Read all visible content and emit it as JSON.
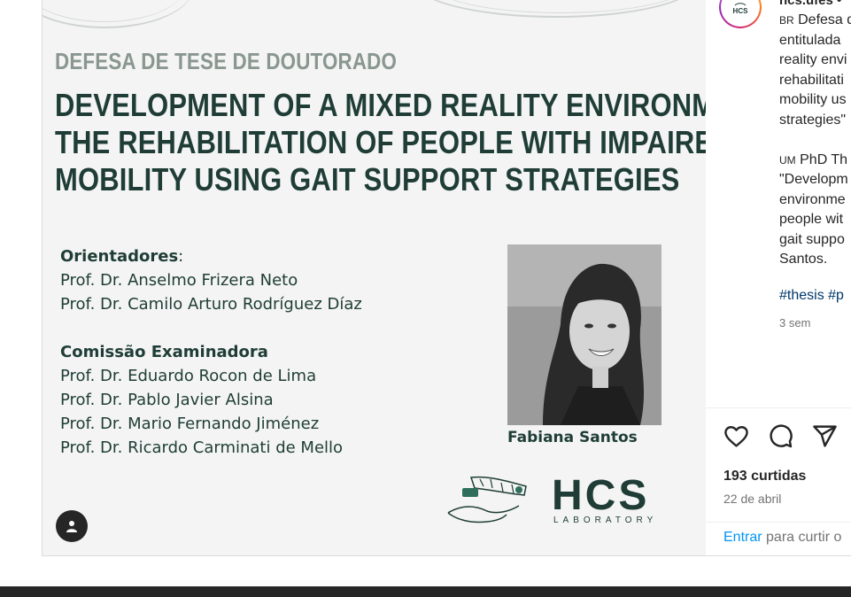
{
  "post": {
    "subtitle": "DEFESA DE TESE DE DOUTORADO",
    "title_lines": [
      "DEVELOPMENT OF A MIXED REALITY ENVIRONMENT FOR",
      "THE REHABILITATION OF PEOPLE WITH IMPAIRED",
      "MOBILITY USING GAIT SUPPORT STRATEGIES"
    ],
    "advisors_heading": "Orientadores",
    "advisors_colon": ":",
    "advisors": [
      "Prof. Dr. Anselmo Frizera Neto",
      "Prof. Dr. Camilo Arturo Rodríguez Díaz"
    ],
    "committee_heading": "Comissão Examinadora",
    "committee": [
      "Prof. Dr. Eduardo Rocon de Lima",
      "Prof. Dr. Pablo Javier Alsina",
      "Prof. Dr. Mario Fernando Jiménez",
      "Prof. Dr. Ricardo Carminati de Mello"
    ],
    "photo_name": "Fabiana Santos",
    "logo_text": "HCS",
    "logo_sub": "LABORATORY"
  },
  "sidebar": {
    "avatar_text": "HCS",
    "username": "hcs.ufes",
    "username_dot": " •",
    "caption_lines": [
      {
        "flag": "BR",
        "text": " Defesa de"
      },
      {
        "flag": "",
        "text": "entitulada"
      },
      {
        "flag": "",
        "text": "reality envi"
      },
      {
        "flag": "",
        "text": "rehabilitati"
      },
      {
        "flag": "",
        "text": "mobility us"
      },
      {
        "flag": "",
        "text": "strategies\""
      }
    ],
    "caption_lines_2": [
      {
        "flag": "UM",
        "text": " PhD Th"
      },
      {
        "flag": "",
        "text": "\"Developm"
      },
      {
        "flag": "",
        "text": "environme"
      },
      {
        "flag": "",
        "text": "people wit"
      },
      {
        "flag": "",
        "text": "gait suppo"
      },
      {
        "flag": "",
        "text": "Santos."
      }
    ],
    "hashtags": "#thesis #p",
    "time_ago": "3 sem",
    "likes": "193 curtidas",
    "date": "22 de abril",
    "login_link": "Entrar",
    "login_rest": " para curtir o"
  },
  "colors": {
    "brand_green": "#1f3d36",
    "subtitle_gray": "#8a9690",
    "link_blue": "#0095f6",
    "hashtag_blue": "#00376b"
  },
  "icons": [
    "heart-icon",
    "comment-icon",
    "share-icon",
    "user-tag-icon"
  ]
}
